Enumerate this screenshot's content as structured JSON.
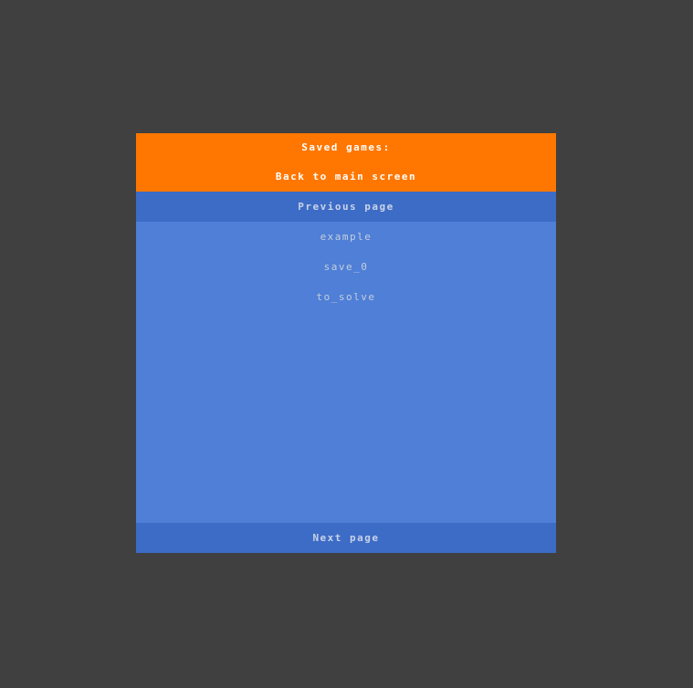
{
  "screen": {
    "title": "Saved games:",
    "back_label": "Back to main screen",
    "prev_label": "Previous page",
    "next_label": "Next page"
  },
  "saves": [
    {
      "label": "example"
    },
    {
      "label": "save_0"
    },
    {
      "label": "to_solve"
    }
  ],
  "colors": {
    "background": "#404040",
    "header": "#ff7700",
    "list": "#4f7fd6",
    "nav": "#3d6cc6"
  }
}
